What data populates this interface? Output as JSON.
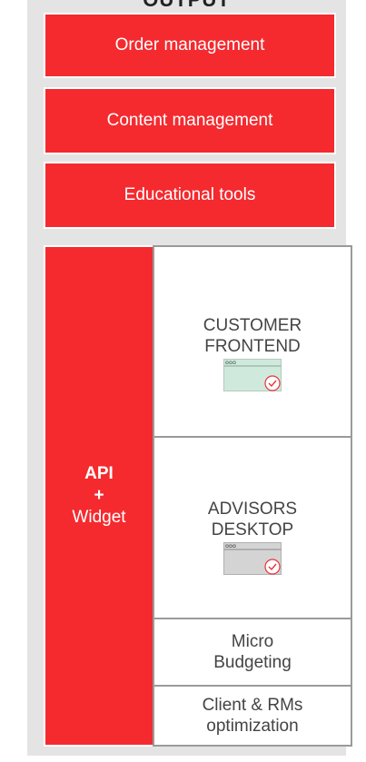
{
  "header": {
    "title": "OUTPUT"
  },
  "modules": [
    {
      "label": "Order management"
    },
    {
      "label": "Content management"
    },
    {
      "label": "Educational tools"
    }
  ],
  "api": {
    "line1": "API",
    "line2": "+",
    "line3": "Widget"
  },
  "channels": {
    "customer": {
      "line1": "CUSTOMER",
      "line2": "FRONTEND",
      "icon": "browser-window-check-icon",
      "icon_color": "#cfe9dc"
    },
    "advisors": {
      "line1": "ADVISORS",
      "line2": "DESKTOP",
      "icon": "browser-window-check-icon",
      "icon_color": "#d4d4d4"
    },
    "micro": {
      "line1": "Micro",
      "line2": "Budgeting"
    },
    "client": {
      "line1": "Client & RMs",
      "line2": "optimization"
    }
  },
  "colors": {
    "accent": "#f42a2f",
    "panel": "#e4e4e4",
    "check": "#e8333a"
  }
}
